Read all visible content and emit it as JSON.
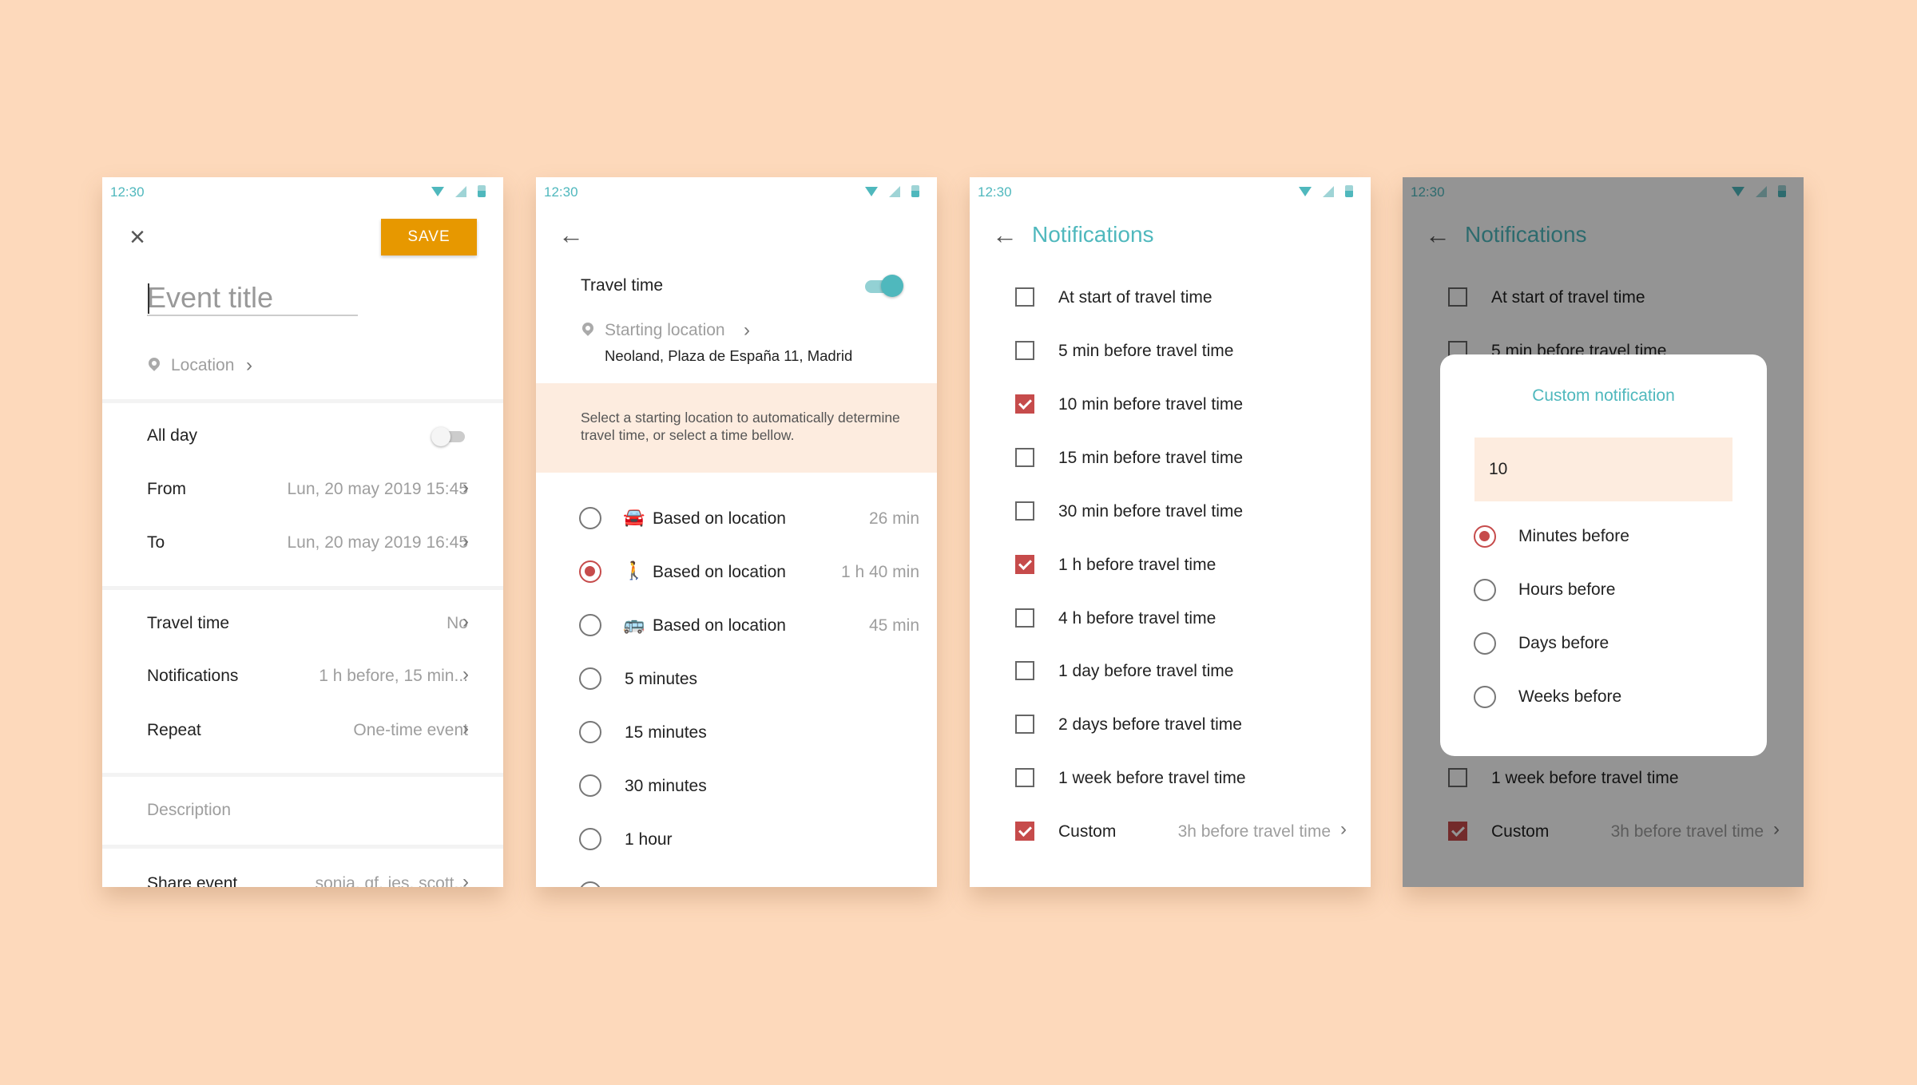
{
  "status_time": "12:30",
  "colors": {
    "background": "#fdd9bb",
    "accent": "#4fb8bd",
    "save": "#e79800",
    "checked": "#c64b4b"
  },
  "screen1": {
    "save_label": "SAVE",
    "title_placeholder": "Event title",
    "location_label": "Location",
    "all_day_label": "All day",
    "all_day_on": false,
    "from_label": "From",
    "from_value": "Lun, 20 may 2019 15:45",
    "to_label": "To",
    "to_value": "Lun, 20 may 2019 16:45",
    "travel_label": "Travel time",
    "travel_value": "No",
    "notifications_label": "Notifications",
    "notifications_value": "1 h before, 15 min...",
    "repeat_label": "Repeat",
    "repeat_value": "One-time event",
    "description_placeholder": "Description",
    "share_label": "Share event",
    "share_value": "sonia, qf, ies, scott..."
  },
  "screen2": {
    "travel_label": "Travel time",
    "travel_on": true,
    "starting_label": "Starting location",
    "address": "Neoland, Plaza de España 11, Madrid",
    "hint": "Select a starting location to automatically determine travel time, or select a time bellow.",
    "options": [
      {
        "label": "Based on location",
        "value": "26 min",
        "icon": "car-icon",
        "selected": false
      },
      {
        "label": "Based on location",
        "value": "1 h 40 min",
        "icon": "walk-icon",
        "selected": true
      },
      {
        "label": "Based on location",
        "value": "45 min",
        "icon": "bus-icon",
        "selected": false
      },
      {
        "label": "5 minutes",
        "value": "",
        "icon": "",
        "selected": false
      },
      {
        "label": "15 minutes",
        "value": "",
        "icon": "",
        "selected": false
      },
      {
        "label": "30 minutes",
        "value": "",
        "icon": "",
        "selected": false
      },
      {
        "label": "1 hour",
        "value": "",
        "icon": "",
        "selected": false
      }
    ]
  },
  "screen3": {
    "title": "Notifications",
    "items": [
      {
        "label": "At start of travel time",
        "checked": false
      },
      {
        "label": "5 min before travel time",
        "checked": false
      },
      {
        "label": "10 min before travel time",
        "checked": true
      },
      {
        "label": "15 min before travel time",
        "checked": false
      },
      {
        "label": "30 min before travel time",
        "checked": false
      },
      {
        "label": "1 h before travel time",
        "checked": true
      },
      {
        "label": "4 h before travel time",
        "checked": false
      },
      {
        "label": "1 day before travel time",
        "checked": false
      },
      {
        "label": "2 days before travel time",
        "checked": false
      },
      {
        "label": "1 week before travel time",
        "checked": false
      },
      {
        "label": "Custom",
        "checked": true,
        "value": "3h before travel time"
      }
    ]
  },
  "screen4": {
    "title": "Notifications",
    "dialog_title": "Custom notification",
    "input_value": "10",
    "options": [
      {
        "label": "Minutes before",
        "selected": true
      },
      {
        "label": "Hours before",
        "selected": false
      },
      {
        "label": "Days before",
        "selected": false
      },
      {
        "label": "Weeks before",
        "selected": false
      }
    ]
  }
}
